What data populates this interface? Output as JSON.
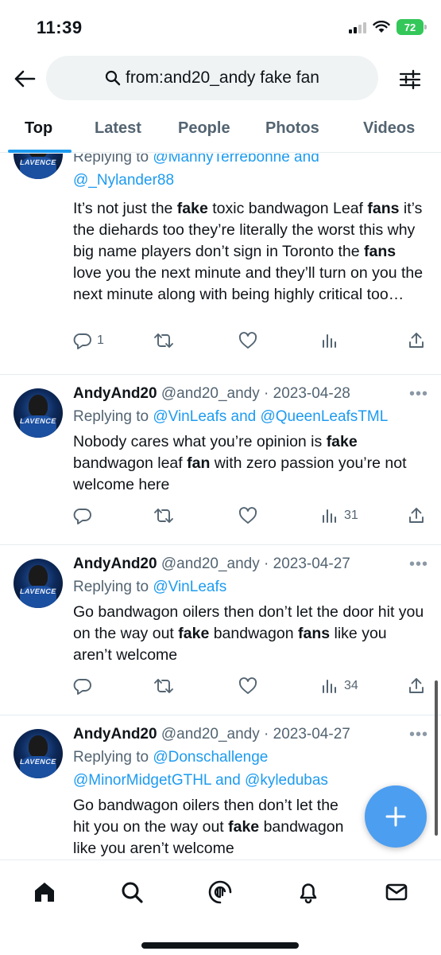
{
  "status_bar": {
    "time": "11:39",
    "battery": "72"
  },
  "search": {
    "query": "from:and20_andy fake fan"
  },
  "tabs": [
    {
      "label": "Top"
    },
    {
      "label": "Latest"
    },
    {
      "label": "People"
    },
    {
      "label": "Photos"
    },
    {
      "label": "Videos"
    }
  ],
  "avatar_text": "LAVENCE",
  "tweets": [
    {
      "reply_prefix": "Replying to ",
      "reply_mentions_1": "@MannyTerrebonne and",
      "reply_mentions_2": "@_Nylander88",
      "replies": "1",
      "views": ""
    },
    {
      "name": "AndyAnd20",
      "handle": "@and20_andy",
      "date": "2023-04-28",
      "reply_prefix": "Replying to ",
      "reply_mentions": "@VinLeafs and @QueenLeafsTML",
      "replies": "",
      "views": "31"
    },
    {
      "name": "AndyAnd20",
      "handle": "@and20_andy",
      "date": "2023-04-27",
      "reply_prefix": "Replying to ",
      "reply_mentions": "@VinLeafs",
      "replies": "",
      "views": "34"
    },
    {
      "name": "AndyAnd20",
      "handle": "@and20_andy",
      "date": "2023-04-27",
      "reply_prefix": "Replying to ",
      "reply_mentions_1": "@Donschallenge",
      "reply_mentions_2": "@MinorMidgetGTHL and @kyledubas"
    }
  ],
  "tweet_texts": {
    "t0": [
      "It’s not just the ",
      "fake",
      " toxic bandwagon Leaf ",
      "fans",
      " it’s the diehards too they’re literally the worst this why big name players don’t sign in Toronto the ",
      "fans",
      " love you the next minute and they’ll turn on you the next minute along with being highly critical too…"
    ],
    "t1": [
      "Nobody cares what you’re opinion is ",
      "fake",
      " bandwagon leaf ",
      "fan",
      " with zero passion you’re not welcome here"
    ],
    "t2": [
      "Go bandwagon oilers then don’t let the door hit you on the way out ",
      "fake",
      " bandwagon ",
      "fans",
      " like you aren’t welcome"
    ],
    "t3_lines": [
      "Go bandwagon oilers then don’t let the",
      "hit you on the way out ",
      "fake",
      " bandwagon",
      "like you aren’t welcome"
    ]
  },
  "colors": {
    "accent": "#1d9bf0",
    "text_primary": "#0f1419",
    "text_secondary": "#536471",
    "battery": "#34c759"
  },
  "icons": {
    "back": "arrow-left-icon",
    "search": "search-icon",
    "filter": "sliders-icon",
    "reply": "reply-icon",
    "retweet": "retweet-icon",
    "like": "heart-icon",
    "views": "views-icon",
    "share": "share-icon",
    "compose": "plus-icon",
    "nav": [
      "home-icon",
      "search-icon",
      "spaces-icon",
      "bell-icon",
      "mail-icon"
    ]
  }
}
